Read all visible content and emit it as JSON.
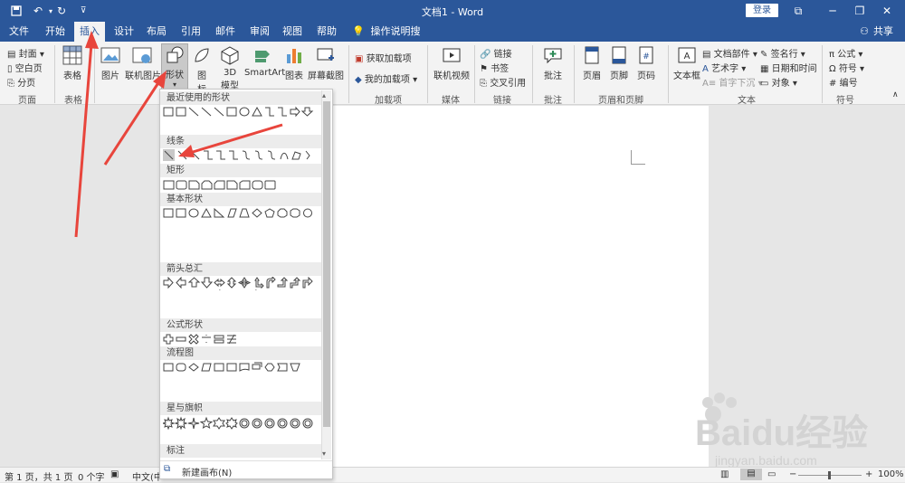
{
  "titlebar": {
    "doc_title": "文档1 - Word",
    "login": "登录"
  },
  "tabs": [
    {
      "label": "文件"
    },
    {
      "label": "开始"
    },
    {
      "label": "插入"
    },
    {
      "label": "设计"
    },
    {
      "label": "布局"
    },
    {
      "label": "引用"
    },
    {
      "label": "邮件"
    },
    {
      "label": "审阅"
    },
    {
      "label": "视图"
    },
    {
      "label": "帮助"
    }
  ],
  "tell_me": "操作说明搜索",
  "share": "共享",
  "ribbon": {
    "pages": {
      "cover": "封面",
      "blank": "空白页",
      "break": "分页",
      "label": "页面"
    },
    "tables": {
      "table": "表格",
      "label": "表格"
    },
    "illus": {
      "picture": "图片",
      "online_picture": "联机图片",
      "shapes": "形状",
      "icons_1": "图",
      "icons_2": "标",
      "model_1": "3D",
      "model_2": "模型",
      "smartart": "SmartArt",
      "chart": "图表",
      "screenshot": "屏幕截图"
    },
    "addins": {
      "get": "获取加载项",
      "my": "我的加载项",
      "label": "加载项"
    },
    "media": {
      "video": "联机视频",
      "label": "媒体"
    },
    "links": {
      "link": "链接",
      "bookmark": "书签",
      "xref": "交叉引用",
      "label": "链接"
    },
    "comments": {
      "comment": "批注",
      "label": "批注"
    },
    "hf": {
      "header": "页眉",
      "footer": "页脚",
      "page_num": "页码",
      "label": "页眉和页脚"
    },
    "text": {
      "textbox": "文本框",
      "parts": "文档部件",
      "wordart": "艺术字",
      "dropcap": "首字下沉",
      "sigline": "签名行",
      "datetime": "日期和时间",
      "object": "对象",
      "label": "文本"
    },
    "symbols": {
      "equation": "公式",
      "symbol": "符号",
      "number": "编号",
      "label": "符号"
    }
  },
  "shapes_menu": {
    "sections": [
      "最近使用的形状",
      "线条",
      "矩形",
      "基本形状",
      "箭头总汇",
      "公式形状",
      "流程图",
      "星与旗帜",
      "标注"
    ],
    "new_canvas": "新建画布(N)"
  },
  "statusbar": {
    "page": "第 1 页，共 1 页",
    "words": "0 个字",
    "lang": "中文(中",
    "zoom": "100%"
  },
  "watermark": {
    "brand": "Baidu经验",
    "url": "jingyan.baidu.com"
  },
  "colors": {
    "accent": "#2b579a",
    "arrow": "#e8453c"
  }
}
